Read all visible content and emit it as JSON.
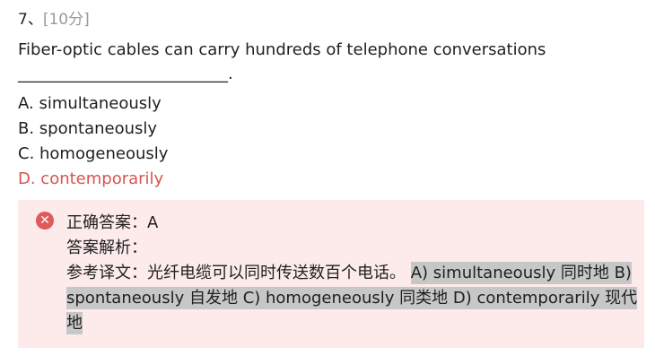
{
  "question": {
    "number": "7、",
    "score": "[10分]",
    "stem": "Fiber-optic cables can carry hundreds of telephone conversations",
    "blank": "__________________________."
  },
  "options": [
    {
      "label": "A. simultaneously",
      "state": "normal"
    },
    {
      "label": "B. spontaneously",
      "state": "normal"
    },
    {
      "label": "C. homogeneously",
      "state": "normal"
    },
    {
      "label": "D. contemporarily",
      "state": "selected-wrong"
    }
  ],
  "result": {
    "icon": "error-circle-icon",
    "correct_answer": "正确答案：A",
    "analysis_label": "答案解析：",
    "translation_label": "参考译文：光纤电缆可以同时传送数百个电话。",
    "highlight_text": "A) simultaneously 同时地 B) spontaneously 自发地 C) homogeneously 同类地 D) contemporarily 现代地"
  },
  "colors": {
    "wrong": "#d9534f",
    "result_bg": "#fdeaea",
    "highlight_bg": "#c7c7c7",
    "muted": "#9a9a9a"
  }
}
